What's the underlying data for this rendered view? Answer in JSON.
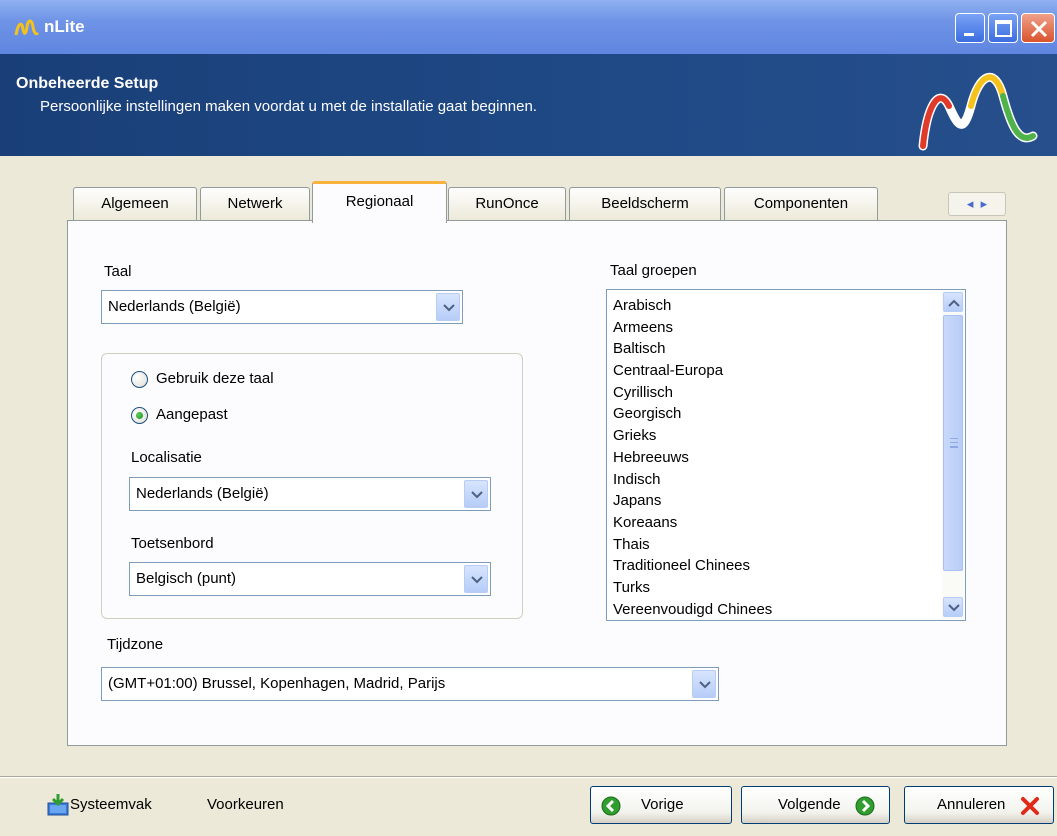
{
  "window": {
    "title": "nLite"
  },
  "header": {
    "title": "Onbeheerde Setup",
    "subtitle": "Persoonlijke instellingen maken voordat u met de installatie gaat beginnen."
  },
  "tabs": [
    {
      "label": "Algemeen",
      "active": false
    },
    {
      "label": "Netwerk",
      "active": false
    },
    {
      "label": "Regionaal",
      "active": true
    },
    {
      "label": "RunOnce",
      "active": false
    },
    {
      "label": "Beeldscherm",
      "active": false
    },
    {
      "label": "Componenten",
      "active": false
    }
  ],
  "tab_scroll": {
    "left_icon": "chevron-left-icon",
    "right_icon": "chevron-right-icon"
  },
  "regional": {
    "taal_label": "Taal",
    "taal_value": "Nederlands (België)",
    "radio_use_language": "Gebruik deze taal",
    "radio_custom": "Aangepast",
    "radio_selected": "Aangepast",
    "localisatie_label": "Localisatie",
    "localisatie_value": "Nederlands (België)",
    "toetsenbord_label": "Toetsenbord",
    "toetsenbord_value": "Belgisch (punt)",
    "tijdzone_label": "Tijdzone",
    "tijdzone_value": "(GMT+01:00) Brussel, Kopenhagen, Madrid, Parijs",
    "taal_groepen_label": "Taal groepen",
    "taal_groepen": [
      "Arabisch",
      "Armeens",
      "Baltisch",
      "Centraal-Europa",
      "Cyrillisch",
      "Georgisch",
      "Grieks",
      "Hebreeuws",
      "Indisch",
      "Japans",
      "Koreaans",
      "Thais",
      "Traditioneel Chinees",
      "Turks",
      "Vereenvoudigd Chinees"
    ]
  },
  "footer": {
    "systray_label": "Systeemvak",
    "preferences_label": "Voorkeuren",
    "back_label": "Vorige",
    "next_label": "Volgende",
    "cancel_label": "Annuleren"
  },
  "colors": {
    "titlebar": "#6e93e6",
    "banner": "#1f4a86",
    "active_tab_accent": "#f7b33b",
    "window_bg": "#ECE9D8"
  }
}
